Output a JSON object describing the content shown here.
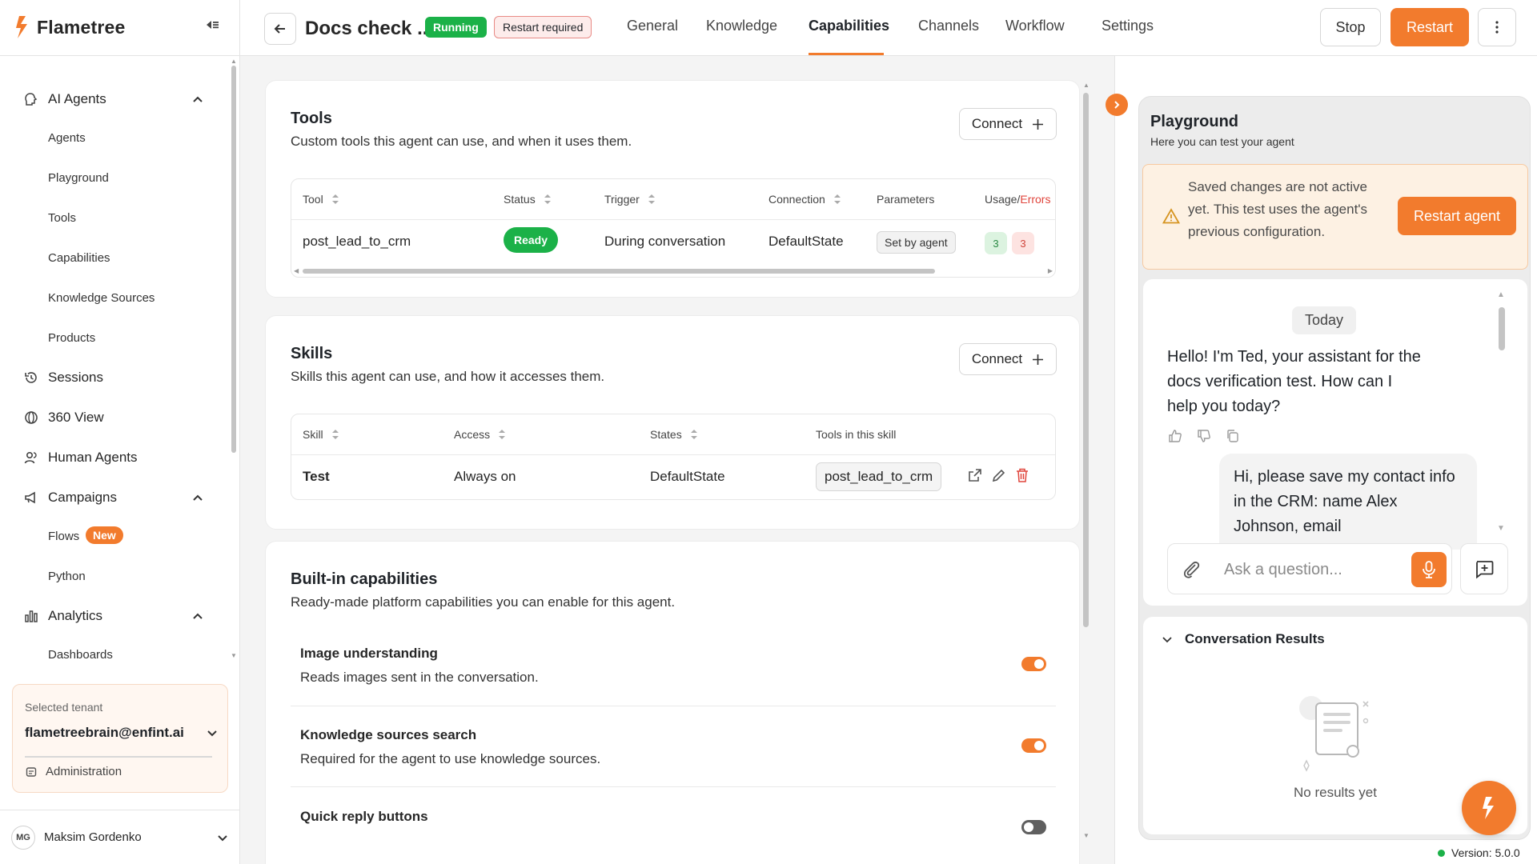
{
  "brand": {
    "name": "Flametree",
    "accent": "#f27b2d"
  },
  "nav": {
    "ai_agents": "AI Agents",
    "agents": "Agents",
    "playground": "Playground",
    "tools": "Tools",
    "capabilities": "Capabilities",
    "knowledge_sources": "Knowledge Sources",
    "products": "Products",
    "sessions": "Sessions",
    "view360": "360 View",
    "human_agents": "Human Agents",
    "campaigns": "Campaigns",
    "flows": "Flows",
    "flows_badge": "New",
    "python": "Python",
    "analytics": "Analytics",
    "dashboards": "Dashboards"
  },
  "tenant": {
    "caption": "Selected tenant",
    "name": "flametreebrain@enfint.ai",
    "admin": "Administration"
  },
  "user": {
    "initials": "MG",
    "name": "Maksim Gordenko"
  },
  "header": {
    "title": "Docs check ...",
    "status": "Running",
    "notice": "Restart required",
    "tabs": [
      "General",
      "Knowledge",
      "Capabilities",
      "Channels",
      "Workflow",
      "Settings"
    ],
    "active_tab": "Capabilities",
    "stop": "Stop",
    "restart": "Restart"
  },
  "tools": {
    "title": "Tools",
    "subtitle": "Custom tools this agent can use, and when it uses them.",
    "connect": "Connect",
    "columns": {
      "tool": "Tool",
      "status": "Status",
      "trigger": "Trigger",
      "connection": "Connection",
      "parameters": "Parameters",
      "usage": "Usage/",
      "errors": "Errors"
    },
    "rows": [
      {
        "tool": "post_lead_to_crm",
        "status": "Ready",
        "trigger": "During conversation",
        "connection": "DefaultState",
        "parameters": "Set by agent",
        "usage": "3",
        "errors": "3"
      }
    ]
  },
  "skills": {
    "title": "Skills",
    "subtitle": "Skills this agent can use, and how it accesses them.",
    "connect": "Connect",
    "columns": {
      "skill": "Skill",
      "access": "Access",
      "states": "States",
      "tools": "Tools in this skill"
    },
    "rows": [
      {
        "skill": "Test",
        "access": "Always on",
        "states": "DefaultState",
        "tools": "post_lead_to_crm"
      }
    ]
  },
  "builtin": {
    "title": "Built-in capabilities",
    "subtitle": "Ready-made platform capabilities you can enable for this agent.",
    "items": [
      {
        "title": "Image understanding",
        "desc": "Reads images sent in the conversation.",
        "enabled": true
      },
      {
        "title": "Knowledge sources search",
        "desc": "Required for the agent to use knowledge sources.",
        "enabled": true
      },
      {
        "title": "Quick reply buttons",
        "desc": "",
        "enabled": false
      }
    ]
  },
  "playground": {
    "title": "Playground",
    "subtitle": "Here you can test your agent",
    "warning": "Saved changes are not active yet. This test uses the agent's previous configuration.",
    "restart_agent": "Restart agent",
    "day": "Today",
    "bot_message": "Hello! I'm Ted, your assistant for the docs verification test. How can I help you today?",
    "user_message": "Hi, please save my contact info in the CRM: name Alex Johnson, email",
    "input_placeholder": "Ask a question...",
    "results_title": "Conversation Results",
    "results_empty": "No results yet"
  },
  "version": "Version: 5.0.0"
}
